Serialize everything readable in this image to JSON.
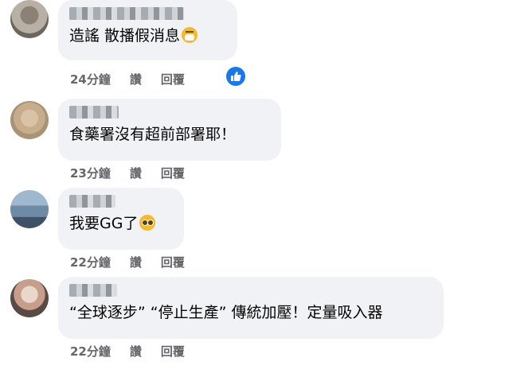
{
  "comments": [
    {
      "text": "造謠 散播假消息",
      "time": "24分鐘",
      "like_label": "讚",
      "reply_label": "回覆",
      "emoji": "face-with-medical-mask",
      "reaction_icon": "like-icon"
    },
    {
      "text": "食藥署沒有超前部署耶！",
      "time": "23分鐘",
      "like_label": "讚",
      "reply_label": "回覆"
    },
    {
      "text": "我要GG了",
      "time": "22分鐘",
      "like_label": "讚",
      "reply_label": "回覆",
      "emoji": "pleading-face"
    },
    {
      "text": "“全球逐步” “停止生產” 傳統加壓！定量吸入器",
      "time": "22分鐘",
      "like_label": "讚",
      "reply_label": "回覆"
    }
  ],
  "colors": {
    "bubble": "#f0f2f5",
    "meta_text": "#65676b",
    "like_blue": "#1877f2"
  }
}
